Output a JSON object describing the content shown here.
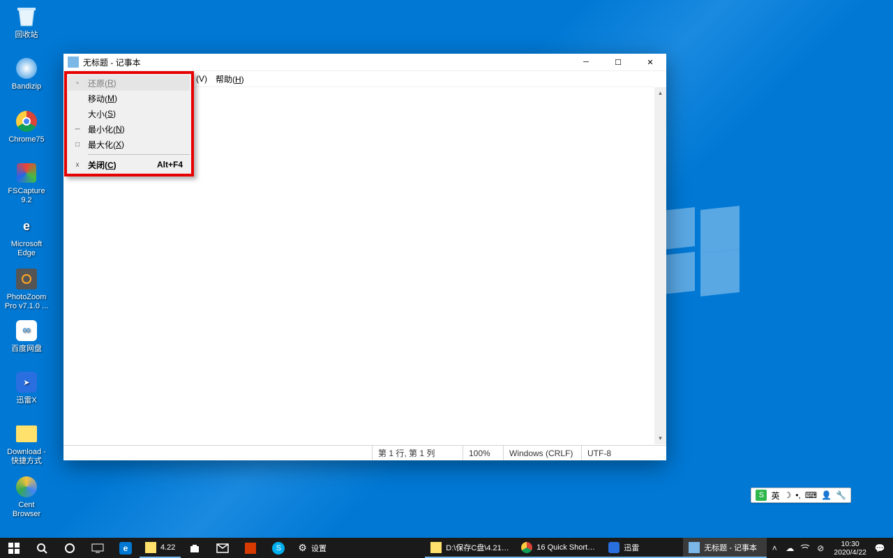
{
  "desktop_icons": [
    {
      "label": "回收站",
      "key": "recycle-bin"
    },
    {
      "label": "Bandizip",
      "key": "bandizip"
    },
    {
      "label": "Chrome75",
      "key": "chrome75"
    },
    {
      "label": "FSCapture\n9.2",
      "key": "fscapture"
    },
    {
      "label": "Microsoft\nEdge",
      "key": "edge"
    },
    {
      "label": "PhotoZoom\nPro v7.1.0 ...",
      "key": "photozoom"
    },
    {
      "label": "百度网盘",
      "key": "baidu-pan"
    },
    {
      "label": "迅雷X",
      "key": "xunlei"
    },
    {
      "label": "Download -\n快捷方式",
      "key": "download"
    },
    {
      "label": "Cent\nBrowser",
      "key": "centbrowser"
    }
  ],
  "notepad": {
    "title": "无标题 - 记事本",
    "menubar": {
      "view_part": "(V)",
      "help_label": "帮助(",
      "help_key": "H",
      "help_close": ")"
    },
    "status": {
      "pos": "第 1 行, 第 1 列",
      "zoom": "100%",
      "eol": "Windows (CRLF)",
      "enc": "UTF-8"
    }
  },
  "sysmenu": {
    "restore": {
      "label": "还原(",
      "key": "R",
      "close": ")"
    },
    "move": {
      "label": "移动(",
      "key": "M",
      "close": ")"
    },
    "size": {
      "label": "大小(",
      "key": "S",
      "close": ")"
    },
    "min": {
      "label": "最小化(",
      "key": "N",
      "close": ")"
    },
    "max": {
      "label": "最大化(",
      "key": "X",
      "close": ")"
    },
    "close": {
      "label": "关闭(",
      "key": "C",
      "close": ")",
      "shortcut": "Alt+F4"
    }
  },
  "ime": {
    "lang": "英",
    "moon": "☽",
    "comma": "•,",
    "grid": "⌨",
    "gear": "🔧"
  },
  "taskbar": {
    "settings_label": "设置",
    "tasks": [
      {
        "label": "4.22",
        "key": "explorer-422"
      },
      {
        "label": "",
        "key": "store"
      },
      {
        "label": "",
        "key": "mail"
      },
      {
        "label": "",
        "key": "office"
      },
      {
        "label": "",
        "key": "skype"
      },
      {
        "label": "设置",
        "key": "settings"
      },
      {
        "label": "D:\\保存C盘\\4.21\\4...",
        "key": "explorer-d"
      },
      {
        "label": "16 Quick Shortcut...",
        "key": "chrome-16"
      },
      {
        "label": "迅雷",
        "key": "xunlei-task"
      },
      {
        "label": "无标题 - 记事本",
        "key": "notepad-task",
        "active": true
      }
    ]
  },
  "tray": {
    "time": "10:30",
    "date": "2020/4/22"
  }
}
